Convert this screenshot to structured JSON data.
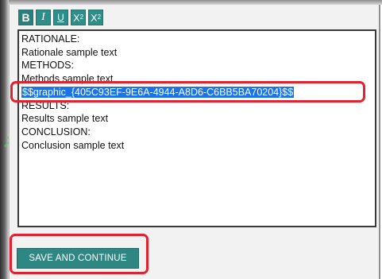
{
  "toolbar": {
    "bold_label": "B",
    "italic_label": "I",
    "underline_label": "U",
    "superscript_label": "X",
    "superscript_mark": "2",
    "subscript_label": "X",
    "subscript_mark": "2"
  },
  "editor": {
    "lines": [
      "RATIONALE:",
      "Rationale sample text",
      "METHODS:",
      "Methods sample text",
      "$$graphic_{405C93EF-9E6A-4944-A8D6-C6BB5BA70204}$$",
      "RESULTS:",
      "Results sample text",
      "CONCLUSION:",
      "Conclusion sample text"
    ],
    "selected_line_index": 4
  },
  "actions": {
    "save_label": "SAVE AND CONTINUE"
  },
  "colors": {
    "accent": "#2f8784",
    "highlight": "#e0232e",
    "selection": "#1a73e8"
  }
}
